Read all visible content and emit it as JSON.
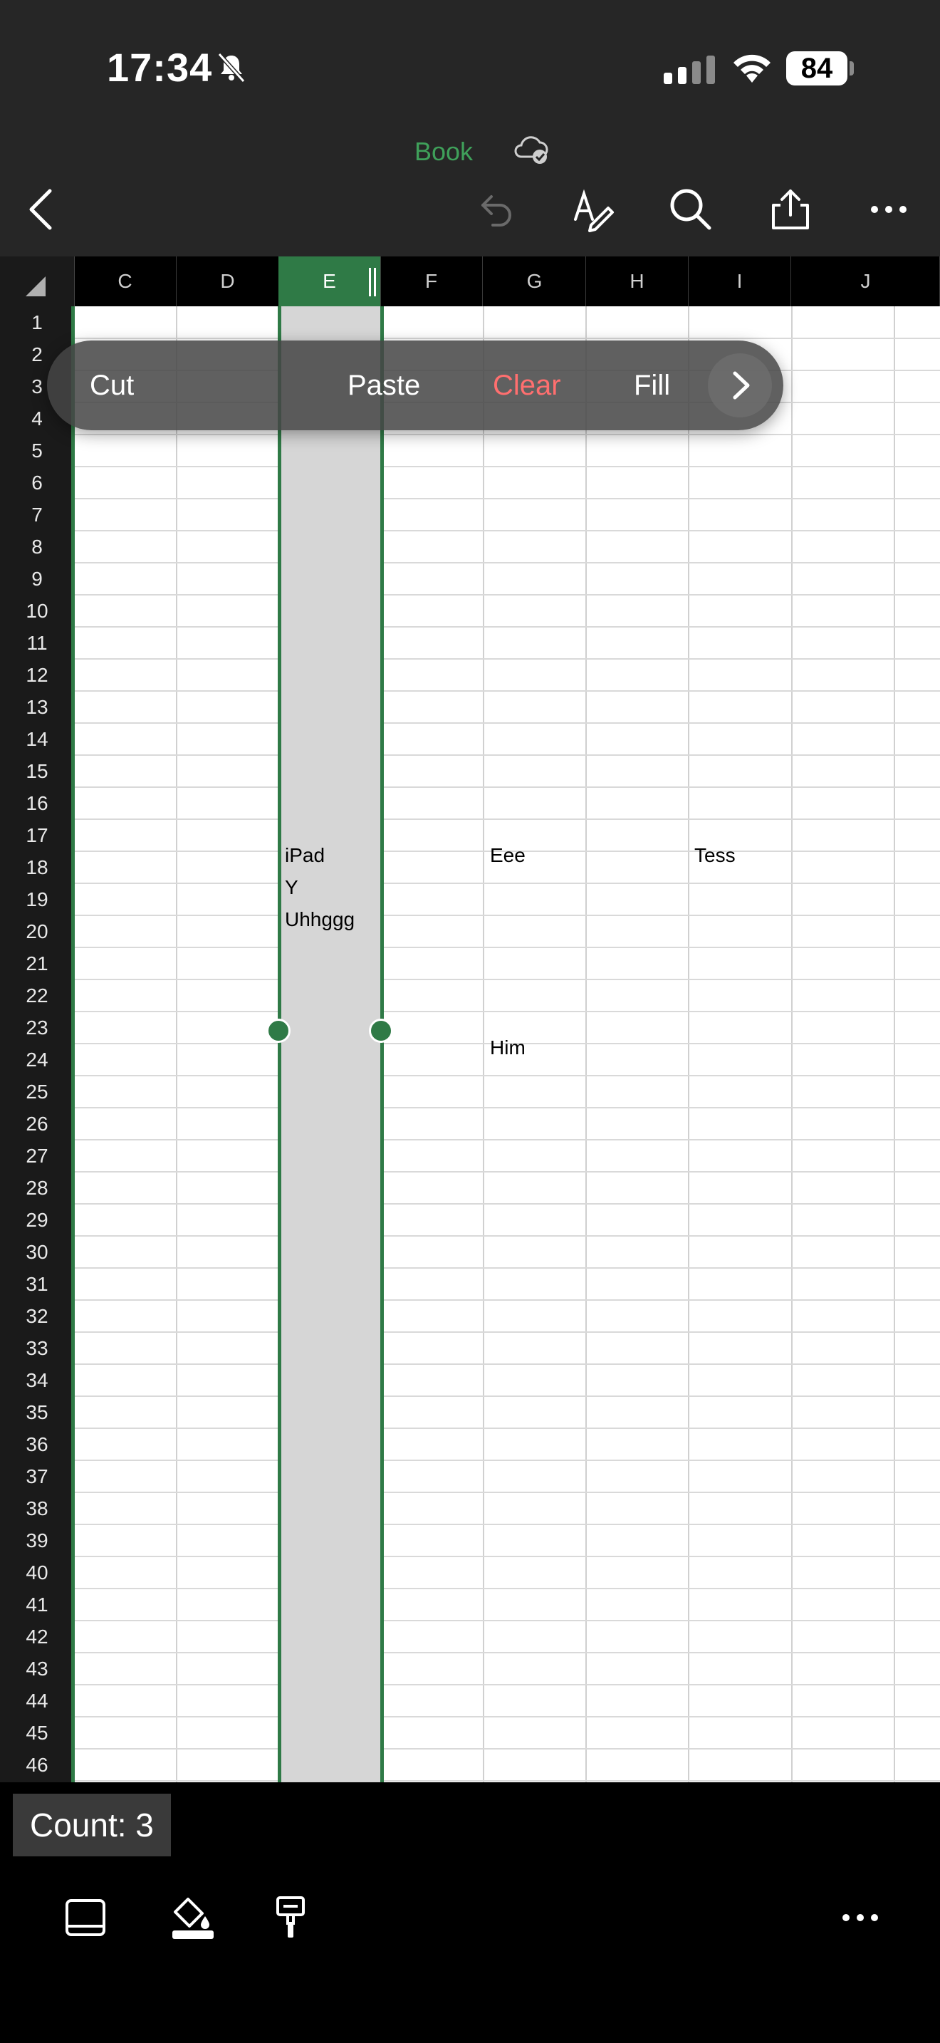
{
  "status": {
    "time": "17:34",
    "battery": "84"
  },
  "toolbar": {
    "document_title": "Book"
  },
  "grid": {
    "columns": [
      "C",
      "D",
      "E",
      "F",
      "G",
      "H",
      "I",
      "J"
    ],
    "selected_column": "E",
    "rows": [
      "1",
      "2",
      "3",
      "4",
      "5",
      "6",
      "7",
      "8",
      "9",
      "10",
      "11",
      "12",
      "13",
      "14",
      "15",
      "16",
      "17",
      "18",
      "19",
      "20",
      "21",
      "22",
      "23",
      "24",
      "25",
      "26",
      "27",
      "28",
      "29",
      "30",
      "31",
      "32",
      "33",
      "34",
      "35",
      "36",
      "37",
      "38",
      "39",
      "40",
      "41",
      "42",
      "43",
      "44",
      "45",
      "46"
    ],
    "cells": {
      "E16": "iPad",
      "E17": "Y",
      "E18": "Uhhggg",
      "G16": "Eee",
      "I16": "Tess",
      "G22": "Him"
    }
  },
  "context_menu": {
    "cut": "Cut",
    "paste": "Paste",
    "clear": "Clear",
    "fill": "Fill"
  },
  "footer": {
    "count": "Count: 3"
  },
  "colors": {
    "accent_green": "#2f7a46",
    "clear_red": "#ff6f6f"
  }
}
